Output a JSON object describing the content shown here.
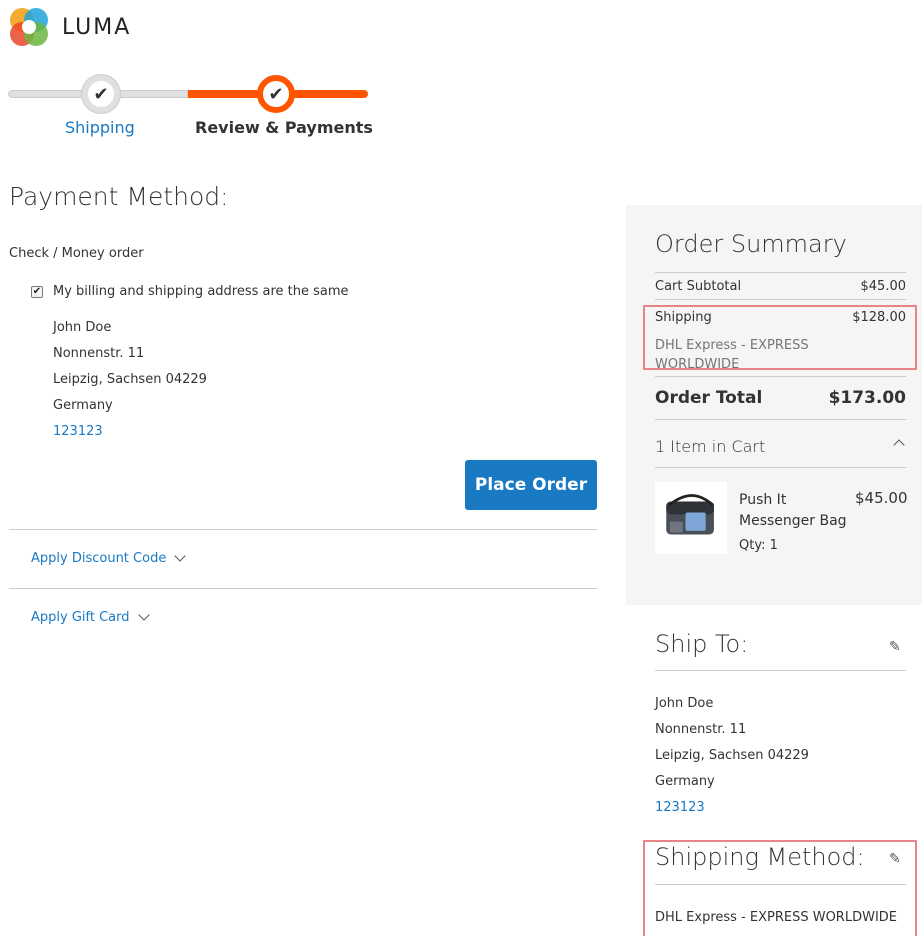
{
  "brand": {
    "name": "LUMA"
  },
  "progress": {
    "steps": [
      {
        "label": "Shipping",
        "state": "done"
      },
      {
        "label": "Review & Payments",
        "state": "active"
      }
    ],
    "check_glyph": "✔"
  },
  "payment": {
    "title": "Payment Method:",
    "method": "Check / Money order",
    "billing_same_label": "My billing and shipping address are the same",
    "billing_same_checked": true,
    "address": {
      "name": "John Doe",
      "street": "Nonnenstr. 11",
      "city_line": "Leipzig, Sachsen 04229",
      "country": "Germany",
      "phone": "123123"
    },
    "place_order_label": "Place Order",
    "discount_label": "Apply Discount Code",
    "gift_card_label": "Apply Gift Card"
  },
  "summary": {
    "title": "Order Summary",
    "cart_subtotal_label": "Cart Subtotal",
    "cart_subtotal_value": "$45.00",
    "shipping_label": "Shipping",
    "shipping_value": "$128.00",
    "shipping_method": "DHL Express - EXPRESS WORLDWIDE",
    "order_total_label": "Order Total",
    "order_total_value": "$173.00",
    "items_in_cart": "1 Item in Cart",
    "item": {
      "name": "Push It Messenger Bag",
      "price": "$45.00",
      "qty": "Qty: 1"
    }
  },
  "ship_to": {
    "title": "Ship To:",
    "address": {
      "name": "John Doe",
      "street": "Nonnenstr. 11",
      "city_line": "Leipzig, Sachsen 04229",
      "country": "Germany",
      "phone": "123123"
    }
  },
  "shipping_method": {
    "title": "Shipping Method:",
    "value": "DHL Express - EXPRESS WORLDWIDE"
  },
  "colors": {
    "accent": "#ff5501",
    "link": "#1979c3",
    "highlight": "#e58585",
    "summary_bg": "#f5f5f5"
  }
}
